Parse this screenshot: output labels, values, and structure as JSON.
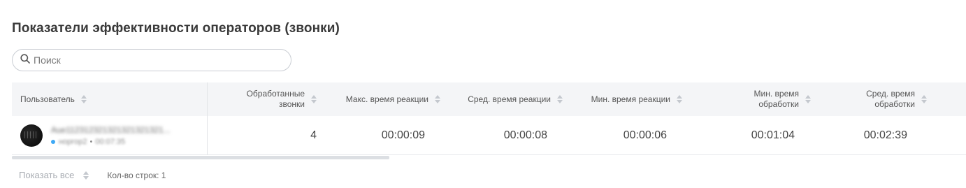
{
  "page": {
    "title": "Показатели эффективности операторов (звонки)"
  },
  "search": {
    "placeholder": "Поиск",
    "value": ""
  },
  "table": {
    "columns": [
      {
        "key": "user",
        "label": "Пользователь"
      },
      {
        "key": "processed",
        "label_line1": "Обработанные",
        "label_line2": "звонки"
      },
      {
        "key": "max_reaction",
        "label": "Макс. время реакции"
      },
      {
        "key": "avg_reaction",
        "label": "Сред. время реакции"
      },
      {
        "key": "min_reaction",
        "label": "Мин. время реакции"
      },
      {
        "key": "min_processing",
        "label_line1": "Мин. время",
        "label_line2": "обработки"
      },
      {
        "key": "avg_processing",
        "label_line1": "Сред. время",
        "label_line2": "обработки"
      }
    ],
    "rows": [
      {
        "user_name": "Aue112312321321321321321...",
        "user_status": "норгор2",
        "user_time": "00:07:35",
        "processed": "4",
        "max_reaction": "00:00:09",
        "avg_reaction": "00:00:08",
        "min_reaction": "00:00:06",
        "min_processing": "00:01:04",
        "avg_processing": "00:02:39"
      }
    ]
  },
  "footer": {
    "show_all_label": "Показать все",
    "rows_count_label": "Кол-во строк: 1"
  },
  "colors": {
    "status_dot": "#3fa9f5",
    "header_bg": "#f4f5f7"
  }
}
